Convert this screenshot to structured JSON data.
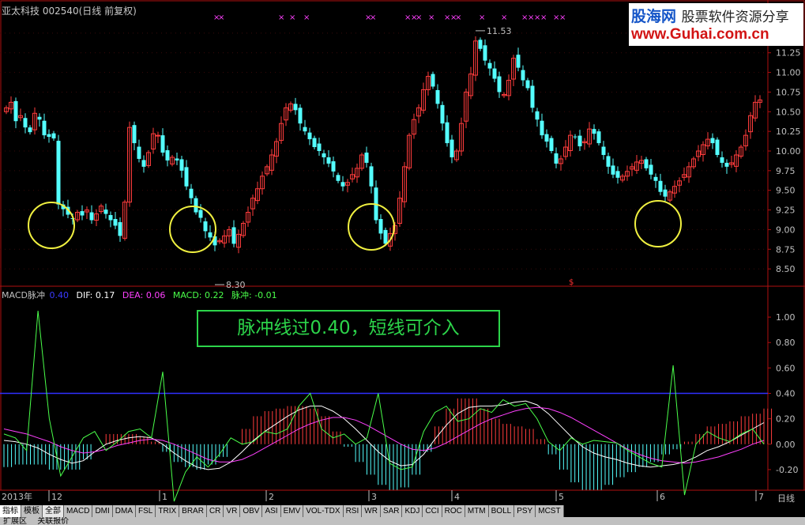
{
  "header": {
    "title": "亚太科技 002540(日线 前复权)"
  },
  "logo": {
    "brand1": "股海网",
    "brand2": "股票软件资源分享",
    "url": "www.Guhai.com.cn"
  },
  "indicator": {
    "name": "MACD脉冲",
    "threshold": "0.40",
    "dif": "DIF: 0.17",
    "dea": "DEA: 0.06",
    "macd": "MACD: 0.22",
    "pulse": "脉冲: -0.01"
  },
  "callout": {
    "text": "脉冲线过0.40，短线可介入"
  },
  "tabs": [
    "指标",
    "模板",
    "全部",
    "MACD",
    "DMI",
    "DMA",
    "FSL",
    "TRIX",
    "BRAR",
    "CR",
    "VR",
    "OBV",
    "ASI",
    "EMV",
    "VOL-TDX",
    "RSI",
    "WR",
    "SAR",
    "KDJ",
    "CCI",
    "ROC",
    "MTM",
    "BOLL",
    "PSY",
    "MCST"
  ],
  "bottom": {
    "items": [
      "扩展区",
      "关联报价"
    ]
  },
  "period_label": "日线",
  "colors": {
    "up": "#ff3c3c",
    "down": "#54ffff",
    "dif": "#ffffff",
    "dea": "#ff40ff",
    "pulse": "#4aff4a",
    "threshold": "#3030ff",
    "circle": "#f0f040",
    "frame": "#b01010"
  },
  "chart_data": [
    {
      "type": "candlestick",
      "title": "亚太科技 002540(日线 前复权)",
      "ylim": [
        8.3,
        11.7
      ],
      "yticks": [
        8.5,
        8.75,
        9.0,
        9.25,
        9.5,
        9.75,
        10.0,
        10.25,
        10.5,
        10.75,
        11.0,
        11.25,
        11.5
      ],
      "x_ticks": [
        "2013年",
        "12",
        "1",
        "2",
        "3",
        "4",
        "5",
        "6",
        "7"
      ],
      "annotations": [
        {
          "label": "11.53",
          "value": 11.53
        },
        {
          "label": "8.30",
          "value": 8.3
        }
      ],
      "closes": [
        10.55,
        10.62,
        10.38,
        10.45,
        10.3,
        10.24,
        10.48,
        10.4,
        10.2,
        10.18,
        10.16,
        9.32,
        9.26,
        9.19,
        9.14,
        9.22,
        9.18,
        9.25,
        9.12,
        9.2,
        9.3,
        9.2,
        9.12,
        9.05,
        8.92,
        9.35,
        10.3,
        10.1,
        9.9,
        9.8,
        9.98,
        10.22,
        10.2,
        9.98,
        9.88,
        9.92,
        9.88,
        9.75,
        9.55,
        9.4,
        9.22,
        9.15,
        8.98,
        8.9,
        8.8,
        8.86,
        8.92,
        9.0,
        8.82,
        8.94,
        9.08,
        9.22,
        9.4,
        9.52,
        9.68,
        9.8,
        9.95,
        10.12,
        10.35,
        10.55,
        10.6,
        10.52,
        10.35,
        10.25,
        10.15,
        10.05,
        10.0,
        9.92,
        9.84,
        9.74,
        9.62,
        9.55,
        9.6,
        9.7,
        9.78,
        9.95,
        9.85,
        9.55,
        9.12,
        8.95,
        8.82,
        8.95,
        9.05,
        9.4,
        9.8,
        10.2,
        10.4,
        10.55,
        10.78,
        10.95,
        10.82,
        10.6,
        10.35,
        10.1,
        9.92,
        10.0,
        10.35,
        10.75,
        10.98,
        11.4,
        11.3,
        11.15,
        11.05,
        10.92,
        10.75,
        10.72,
        10.9,
        11.18,
        11.06,
        10.9,
        10.8,
        10.55,
        10.4,
        10.2,
        10.12,
        10.0,
        9.84,
        9.9,
        10.05,
        10.2,
        10.18,
        10.06,
        10.12,
        10.28,
        10.22,
        10.1,
        9.95,
        9.8,
        9.7,
        9.66,
        9.68,
        9.74,
        9.8,
        9.86,
        9.88,
        9.78,
        9.7,
        9.62,
        9.48,
        9.42,
        9.48,
        9.55,
        9.62,
        9.7,
        9.8,
        9.9,
        10.0,
        10.08,
        10.15,
        10.1,
        9.95,
        9.85,
        9.8,
        9.85,
        9.95,
        10.05,
        10.2,
        10.45,
        10.62,
        10.65
      ]
    },
    {
      "type": "line",
      "title": "MACD脉冲",
      "ylim": [
        -0.3,
        1.1
      ],
      "yticks": [
        -0.2,
        0.0,
        0.2,
        0.4,
        0.6,
        0.8,
        1.0
      ],
      "threshold": 0.4,
      "series": [
        {
          "name": "DIF",
          "values": [
            0.03,
            0.02,
            0.0,
            -0.03,
            -0.08,
            -0.12,
            -0.15,
            -0.13,
            -0.06,
            0.0,
            0.03,
            0.05,
            0.06,
            0.05,
            0.0,
            -0.07,
            -0.13,
            -0.18,
            -0.2,
            -0.19,
            -0.14,
            -0.06,
            0.03,
            0.1,
            0.16,
            0.22,
            0.27,
            0.3,
            0.3,
            0.26,
            0.2,
            0.12,
            0.03,
            -0.06,
            -0.13,
            -0.17,
            -0.16,
            -0.08,
            0.04,
            0.15,
            0.24,
            0.29,
            0.3,
            0.3,
            0.31,
            0.33,
            0.34,
            0.31,
            0.24,
            0.15,
            0.06,
            -0.02,
            -0.07,
            -0.1,
            -0.12,
            -0.15,
            -0.17,
            -0.18,
            -0.17,
            -0.16,
            -0.14,
            -0.1,
            -0.05,
            -0.02,
            0.02,
            0.07,
            0.12,
            0.17
          ]
        },
        {
          "name": "DEA",
          "values": [
            0.12,
            0.1,
            0.08,
            0.05,
            0.02,
            -0.02,
            -0.05,
            -0.07,
            -0.06,
            -0.04,
            -0.01,
            0.01,
            0.03,
            0.04,
            0.03,
            0.0,
            -0.04,
            -0.08,
            -0.12,
            -0.14,
            -0.14,
            -0.12,
            -0.08,
            -0.03,
            0.02,
            0.07,
            0.12,
            0.16,
            0.19,
            0.21,
            0.21,
            0.19,
            0.15,
            0.1,
            0.05,
            0.0,
            -0.04,
            -0.05,
            -0.03,
            0.01,
            0.06,
            0.11,
            0.16,
            0.2,
            0.23,
            0.26,
            0.28,
            0.29,
            0.28,
            0.25,
            0.21,
            0.16,
            0.11,
            0.06,
            0.01,
            -0.04,
            -0.08,
            -0.11,
            -0.13,
            -0.14,
            -0.15,
            -0.14,
            -0.12,
            -0.1,
            -0.07,
            -0.04,
            0.0,
            0.03
          ]
        },
        {
          "name": "脉冲",
          "values": [
            0.08,
            0.05,
            -0.05,
            1.05,
            0.2,
            -0.25,
            -0.1,
            0.05,
            0.1,
            -0.05,
            0.02,
            0.1,
            0.12,
            0.05,
            0.57,
            -0.45,
            -0.22,
            -0.1,
            -0.18,
            -0.08,
            0.05,
            0.0,
            0.02,
            0.1,
            0.08,
            0.12,
            0.3,
            0.4,
            0.12,
            0.05,
            0.08,
            0.0,
            0.05,
            0.4,
            -0.15,
            -0.2,
            -0.18,
            0.1,
            0.25,
            0.3,
            0.18,
            0.2,
            0.28,
            0.25,
            0.35,
            0.3,
            0.32,
            0.2,
            0.02,
            -0.05,
            0.05,
            0.0,
            0.03,
            0.02,
            0.01,
            -0.05,
            -0.1,
            -0.15,
            -0.18,
            0.62,
            -0.4,
            0.0,
            0.1,
            0.05,
            0.02,
            0.08,
            0.12,
            0.0
          ]
        }
      ]
    }
  ]
}
